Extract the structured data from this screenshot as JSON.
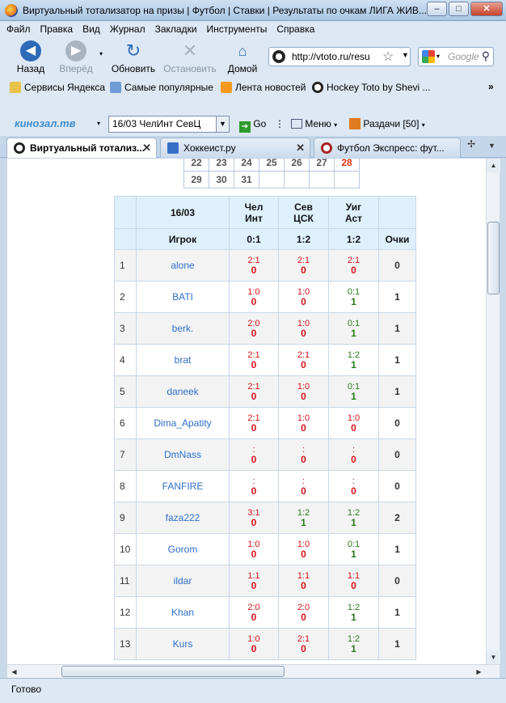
{
  "window": {
    "title": "Виртуальный тотализатор на призы | Футбол | Ставки | Результаты по очкам ЛИГА ЖИВ..."
  },
  "menu": [
    "Файл",
    "Правка",
    "Вид",
    "Журнал",
    "Закладки",
    "Инструменты",
    "Справка"
  ],
  "nav": {
    "back": "Назад",
    "forward": "Вперёд",
    "reload": "Обновить",
    "stop": "Остановить",
    "home": "Домой",
    "url": "http://vtoto.ru/resu",
    "search_placeholder": "Google"
  },
  "bookmarks": [
    "Сервисы Яндекса",
    "Самые популярные",
    "Лента новостей",
    "Hockey Toto by Shevi ..."
  ],
  "toolbar2": {
    "logo": "кинозал.тв",
    "combo_value": "16/03    ЧелИнт СевЦ",
    "go": "Go",
    "menu": "Меню",
    "downloads": "Раздачи [50]"
  },
  "tabs": [
    {
      "label": "Виртуальный тотализ...",
      "active": true
    },
    {
      "label": "Хоккеист.ру",
      "active": false
    },
    {
      "label": "Футбол Экспресс: фут...",
      "active": false
    }
  ],
  "calendar": {
    "rows": [
      [
        "22",
        "23",
        "24",
        "25",
        "26",
        "27",
        "28"
      ],
      [
        "29",
        "30",
        "31",
        "",
        "",
        "",
        ""
      ]
    ]
  },
  "results": {
    "date": "16/03",
    "matches": [
      {
        "team1": "Чел",
        "team2": "Инт",
        "score": "0:1"
      },
      {
        "team1": "Сев",
        "team2": "ЦСК",
        "score": "1:2"
      },
      {
        "team1": "Уиг",
        "team2": "Аст",
        "score": "1:2"
      }
    ],
    "player_header": "Игрок",
    "points_header": "Очки",
    "rows": [
      {
        "n": "1",
        "name": "alone",
        "p": [
          [
            "2:1",
            "0"
          ],
          [
            "2:1",
            "0"
          ],
          [
            "2:1",
            "0"
          ]
        ],
        "total": "0"
      },
      {
        "n": "2",
        "name": "BATI",
        "p": [
          [
            "1:0",
            "0"
          ],
          [
            "1:0",
            "0"
          ],
          [
            "0:1",
            "1"
          ]
        ],
        "total": "1"
      },
      {
        "n": "3",
        "name": "berk.",
        "p": [
          [
            "2:0",
            "0"
          ],
          [
            "1:0",
            "0"
          ],
          [
            "0:1",
            "1"
          ]
        ],
        "total": "1"
      },
      {
        "n": "4",
        "name": "brat",
        "p": [
          [
            "2:1",
            "0"
          ],
          [
            "2:1",
            "0"
          ],
          [
            "1:2",
            "1"
          ]
        ],
        "total": "1"
      },
      {
        "n": "5",
        "name": "daneek",
        "p": [
          [
            "2:1",
            "0"
          ],
          [
            "1:0",
            "0"
          ],
          [
            "0:1",
            "1"
          ]
        ],
        "total": "1"
      },
      {
        "n": "6",
        "name": "Dima_Apatity",
        "p": [
          [
            "2:1",
            "0"
          ],
          [
            "1:0",
            "0"
          ],
          [
            "1:0",
            "0"
          ]
        ],
        "total": "0"
      },
      {
        "n": "7",
        "name": "DmNass",
        "p": [
          [
            ":",
            "0"
          ],
          [
            ":",
            "0"
          ],
          [
            ":",
            "0"
          ]
        ],
        "total": "0"
      },
      {
        "n": "8",
        "name": "FANFIRE",
        "p": [
          [
            ":",
            "0"
          ],
          [
            ":",
            "0"
          ],
          [
            ":",
            "0"
          ]
        ],
        "total": "0"
      },
      {
        "n": "9",
        "name": "faza222",
        "p": [
          [
            "3:1",
            "0"
          ],
          [
            "1:2",
            "1"
          ],
          [
            "1:2",
            "1"
          ]
        ],
        "total": "2"
      },
      {
        "n": "10",
        "name": "Gorom",
        "p": [
          [
            "1:0",
            "0"
          ],
          [
            "1:0",
            "0"
          ],
          [
            "0:1",
            "1"
          ]
        ],
        "total": "1"
      },
      {
        "n": "11",
        "name": "ildar",
        "p": [
          [
            "1:1",
            "0"
          ],
          [
            "1:1",
            "0"
          ],
          [
            "1:1",
            "0"
          ]
        ],
        "total": "0"
      },
      {
        "n": "12",
        "name": "Khan",
        "p": [
          [
            "2:0",
            "0"
          ],
          [
            "2:0",
            "0"
          ],
          [
            "1:2",
            "1"
          ]
        ],
        "total": "1"
      },
      {
        "n": "13",
        "name": "Kurs",
        "p": [
          [
            "1:0",
            "0"
          ],
          [
            "2:1",
            "0"
          ],
          [
            "1:2",
            "1"
          ]
        ],
        "total": "1"
      }
    ]
  },
  "status": "Готово",
  "colors": {
    "wrong": "#d7141a",
    "right": "#2a7a1a",
    "player_link": "#2f6fc9",
    "header_bg": "#def0fc"
  }
}
